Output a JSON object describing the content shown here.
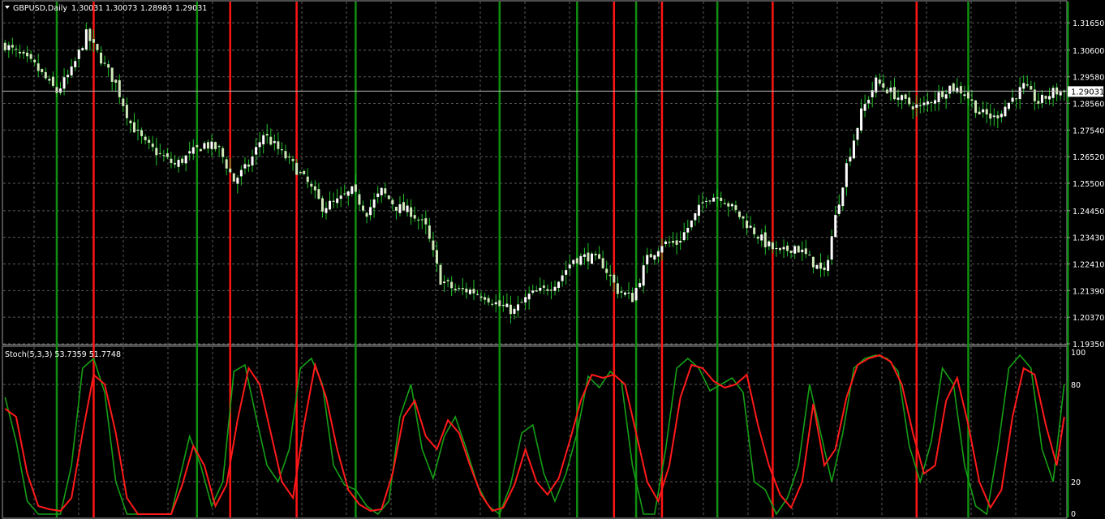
{
  "main_header": {
    "symbol": "GBPUSD,Daily",
    "open": "1.30031",
    "high": "1.30073",
    "low": "1.28983",
    "close": "1.29031"
  },
  "indicator_header": "Stoch(5,3,3) 53.7359 51.7748",
  "current_price_label": "1.29031",
  "colors": {
    "background": "#000000",
    "grid": "#5a5a5a",
    "bull_candle": "#ffffff",
    "bear_candle": "#cfe9b8",
    "wick": "#22c22a",
    "main_line": "#15a015",
    "signal_line": "#ff1a1a",
    "green_vertical": "#0f8f0f",
    "red_vertical": "#ff1414"
  },
  "chart_data": [
    {
      "type": "candlestick",
      "title": "GBPUSD,Daily",
      "y_ticks": [
        "1.31650",
        "1.30600",
        "1.29580",
        "1.28560",
        "1.27540",
        "1.26520",
        "1.25500",
        "1.24450",
        "1.23430",
        "1.22410",
        "1.21390",
        "1.20370",
        "1.19350"
      ],
      "ylim": [
        1.1935,
        1.3215
      ],
      "current_price": 1.29031,
      "close_profile": [
        [
          0,
          1.308
        ],
        [
          8,
          1.3
        ],
        [
          14,
          1.29
        ],
        [
          18,
          1.298
        ],
        [
          22,
          1.312
        ],
        [
          25,
          1.305
        ],
        [
          30,
          1.293
        ],
        [
          34,
          1.278
        ],
        [
          38,
          1.27
        ],
        [
          42,
          1.266
        ],
        [
          46,
          1.262
        ],
        [
          50,
          1.266
        ],
        [
          54,
          1.27
        ],
        [
          58,
          1.268
        ],
        [
          62,
          1.256
        ],
        [
          66,
          1.262
        ],
        [
          70,
          1.274
        ],
        [
          74,
          1.268
        ],
        [
          78,
          1.262
        ],
        [
          82,
          1.255
        ],
        [
          86,
          1.246
        ],
        [
          90,
          1.248
        ],
        [
          94,
          1.252
        ],
        [
          98,
          1.244
        ],
        [
          102,
          1.252
        ],
        [
          106,
          1.246
        ],
        [
          110,
          1.244
        ],
        [
          114,
          1.238
        ],
        [
          118,
          1.218
        ],
        [
          122,
          1.214
        ],
        [
          126,
          1.214
        ],
        [
          130,
          1.212
        ],
        [
          134,
          1.208
        ],
        [
          138,
          1.206
        ],
        [
          142,
          1.212
        ],
        [
          146,
          1.214
        ],
        [
          150,
          1.218
        ],
        [
          154,
          1.226
        ],
        [
          158,
          1.227
        ],
        [
          162,
          1.224
        ],
        [
          166,
          1.214
        ],
        [
          170,
          1.211
        ],
        [
          174,
          1.226
        ],
        [
          178,
          1.232
        ],
        [
          182,
          1.232
        ],
        [
          186,
          1.24
        ],
        [
          190,
          1.25
        ],
        [
          194,
          1.25
        ],
        [
          198,
          1.244
        ],
        [
          202,
          1.238
        ],
        [
          206,
          1.232
        ],
        [
          210,
          1.228
        ],
        [
          214,
          1.231
        ],
        [
          218,
          1.226
        ],
        [
          222,
          1.22
        ],
        [
          225,
          1.242
        ],
        [
          228,
          1.262
        ],
        [
          232,
          1.282
        ],
        [
          236,
          1.294
        ],
        [
          240,
          1.29
        ],
        [
          244,
          1.286
        ],
        [
          248,
          1.284
        ],
        [
          252,
          1.288
        ],
        [
          256,
          1.292
        ],
        [
          260,
          1.29
        ],
        [
          264,
          1.282
        ],
        [
          268,
          1.28
        ],
        [
          272,
          1.286
        ],
        [
          276,
          1.292
        ],
        [
          280,
          1.286
        ],
        [
          284,
          1.29
        ],
        [
          287,
          1.29
        ]
      ],
      "candle_count": 288
    },
    {
      "type": "line",
      "title": "Stoch(5,3,3) 53.7359 51.7748",
      "y_ticks": [
        "100",
        "80",
        "20",
        "0"
      ],
      "ylim": [
        0,
        100
      ],
      "series": [
        {
          "name": "main",
          "color": "#15a015",
          "points": [
            [
              0,
              72
            ],
            [
              3,
              45
            ],
            [
              6,
              8
            ],
            [
              9,
              0
            ],
            [
              15,
              0
            ],
            [
              18,
              30
            ],
            [
              21,
              90
            ],
            [
              24,
              96
            ],
            [
              27,
              75
            ],
            [
              30,
              20
            ],
            [
              33,
              0
            ],
            [
              45,
              0
            ],
            [
              50,
              48
            ],
            [
              53,
              30
            ],
            [
              56,
              5
            ],
            [
              59,
              20
            ],
            [
              62,
              88
            ],
            [
              65,
              92
            ],
            [
              68,
              60
            ],
            [
              71,
              30
            ],
            [
              74,
              20
            ],
            [
              77,
              40
            ],
            [
              80,
              90
            ],
            [
              83,
              96
            ],
            [
              86,
              80
            ],
            [
              89,
              30
            ],
            [
              92,
              18
            ],
            [
              95,
              15
            ],
            [
              98,
              5
            ],
            [
              101,
              0
            ],
            [
              104,
              8
            ],
            [
              107,
              60
            ],
            [
              110,
              80
            ],
            [
              113,
              40
            ],
            [
              116,
              22
            ],
            [
              119,
              48
            ],
            [
              122,
              60
            ],
            [
              125,
              40
            ],
            [
              128,
              18
            ],
            [
              131,
              5
            ],
            [
              134,
              0
            ],
            [
              137,
              18
            ],
            [
              140,
              50
            ],
            [
              143,
              55
            ],
            [
              146,
              25
            ],
            [
              149,
              8
            ],
            [
              152,
              25
            ],
            [
              155,
              50
            ],
            [
              158,
              85
            ],
            [
              161,
              78
            ],
            [
              164,
              88
            ],
            [
              167,
              82
            ],
            [
              170,
              30
            ],
            [
              173,
              0
            ],
            [
              176,
              0
            ],
            [
              179,
              40
            ],
            [
              182,
              90
            ],
            [
              185,
              96
            ],
            [
              188,
              90
            ],
            [
              191,
              76
            ],
            [
              194,
              80
            ],
            [
              197,
              84
            ],
            [
              200,
              75
            ],
            [
              203,
              20
            ],
            [
              206,
              15
            ],
            [
              209,
              0
            ],
            [
              212,
              10
            ],
            [
              215,
              30
            ],
            [
              218,
              80
            ],
            [
              221,
              50
            ],
            [
              224,
              20
            ],
            [
              227,
              50
            ],
            [
              230,
              90
            ],
            [
              233,
              96
            ],
            [
              236,
              98
            ],
            [
              239,
              96
            ],
            [
              242,
              88
            ],
            [
              245,
              42
            ],
            [
              248,
              20
            ],
            [
              251,
              45
            ],
            [
              254,
              90
            ],
            [
              257,
              80
            ],
            [
              260,
              30
            ],
            [
              263,
              5
            ],
            [
              266,
              0
            ],
            [
              269,
              40
            ],
            [
              272,
              90
            ],
            [
              275,
              98
            ],
            [
              278,
              90
            ],
            [
              281,
              40
            ],
            [
              284,
              20
            ],
            [
              287,
              80
            ]
          ]
        },
        {
          "name": "signal",
          "color": "#ff1a1a",
          "points": [
            [
              0,
              65
            ],
            [
              3,
              60
            ],
            [
              6,
              25
            ],
            [
              9,
              5
            ],
            [
              12,
              3
            ],
            [
              15,
              2
            ],
            [
              18,
              10
            ],
            [
              21,
              50
            ],
            [
              24,
              86
            ],
            [
              27,
              80
            ],
            [
              30,
              50
            ],
            [
              33,
              10
            ],
            [
              36,
              0
            ],
            [
              45,
              0
            ],
            [
              48,
              18
            ],
            [
              51,
              42
            ],
            [
              54,
              30
            ],
            [
              57,
              5
            ],
            [
              60,
              18
            ],
            [
              63,
              58
            ],
            [
              66,
              90
            ],
            [
              69,
              80
            ],
            [
              72,
              50
            ],
            [
              75,
              20
            ],
            [
              78,
              10
            ],
            [
              81,
              55
            ],
            [
              84,
              92
            ],
            [
              87,
              72
            ],
            [
              90,
              40
            ],
            [
              93,
              15
            ],
            [
              96,
              6
            ],
            [
              99,
              2
            ],
            [
              102,
              3
            ],
            [
              105,
              25
            ],
            [
              108,
              60
            ],
            [
              111,
              70
            ],
            [
              114,
              48
            ],
            [
              117,
              40
            ],
            [
              120,
              58
            ],
            [
              123,
              50
            ],
            [
              126,
              30
            ],
            [
              129,
              12
            ],
            [
              132,
              2
            ],
            [
              135,
              4
            ],
            [
              138,
              18
            ],
            [
              141,
              40
            ],
            [
              144,
              20
            ],
            [
              147,
              12
            ],
            [
              150,
              22
            ],
            [
              153,
              45
            ],
            [
              156,
              70
            ],
            [
              159,
              86
            ],
            [
              162,
              84
            ],
            [
              165,
              86
            ],
            [
              168,
              80
            ],
            [
              171,
              50
            ],
            [
              174,
              20
            ],
            [
              177,
              8
            ],
            [
              180,
              30
            ],
            [
              183,
              72
            ],
            [
              186,
              92
            ],
            [
              189,
              90
            ],
            [
              192,
              82
            ],
            [
              195,
              78
            ],
            [
              198,
              80
            ],
            [
              201,
              86
            ],
            [
              204,
              55
            ],
            [
              207,
              30
            ],
            [
              210,
              12
            ],
            [
              213,
              4
            ],
            [
              216,
              20
            ],
            [
              219,
              68
            ],
            [
              222,
              30
            ],
            [
              225,
              40
            ],
            [
              228,
              72
            ],
            [
              231,
              92
            ],
            [
              234,
              96
            ],
            [
              237,
              98
            ],
            [
              240,
              94
            ],
            [
              243,
              80
            ],
            [
              246,
              50
            ],
            [
              249,
              25
            ],
            [
              252,
              30
            ],
            [
              255,
              70
            ],
            [
              258,
              84
            ],
            [
              261,
              55
            ],
            [
              264,
              20
            ],
            [
              267,
              4
            ],
            [
              270,
              15
            ],
            [
              273,
              60
            ],
            [
              276,
              90
            ],
            [
              279,
              86
            ],
            [
              282,
              55
            ],
            [
              285,
              30
            ],
            [
              287,
              60
            ]
          ]
        }
      ],
      "green_vertical_bars": [
        14,
        52,
        95,
        134,
        155,
        171,
        193,
        261,
        288
      ],
      "red_vertical_bars": [
        24,
        61,
        79,
        165,
        178,
        208,
        247
      ],
      "candle_count": 288
    }
  ]
}
